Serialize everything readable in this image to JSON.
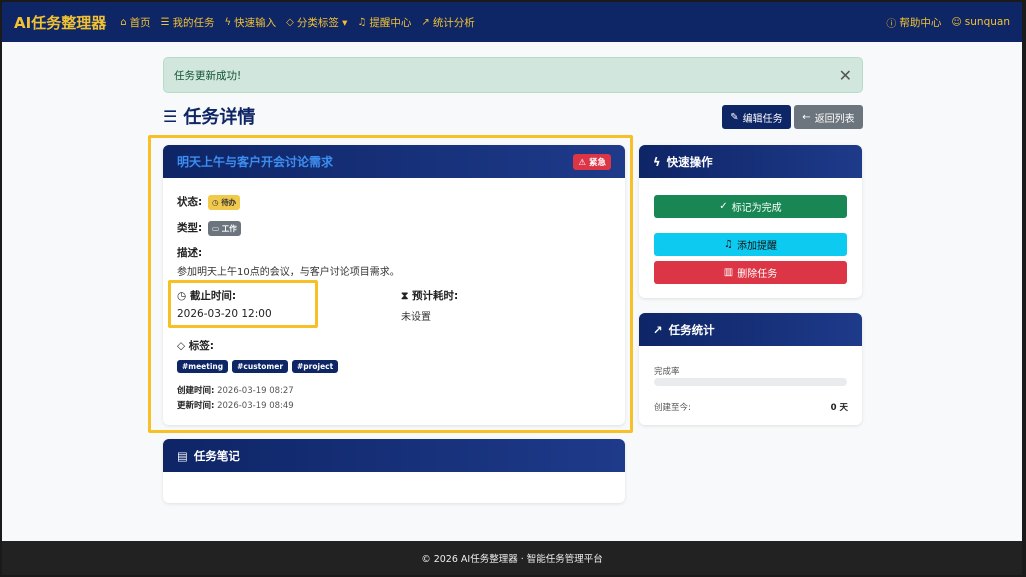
{
  "navbar": {
    "brand": "AI任务整理器",
    "items": [
      {
        "icon": "home-icon",
        "glyph": "⌂",
        "label": "首页"
      },
      {
        "icon": "list-icon",
        "glyph": "☰",
        "label": "我的任务"
      },
      {
        "icon": "lightning-icon",
        "glyph": "ϟ",
        "label": "快速输入"
      },
      {
        "icon": "tag-icon",
        "glyph": "◇",
        "label": "分类标签 ▾"
      },
      {
        "icon": "bell-icon",
        "glyph": "♫",
        "label": "提醒中心"
      },
      {
        "icon": "chart-icon",
        "glyph": "↗",
        "label": "统计分析"
      }
    ],
    "help": "帮助中心",
    "user": "sunquan"
  },
  "alert": {
    "text": "任务更新成功!"
  },
  "page": {
    "title": "任务详情",
    "edit_label": "编辑任务",
    "back_label": "返回列表"
  },
  "task": {
    "title": "明天上午与客户开会讨论需求",
    "priority": "紧急",
    "status_label": "状态:",
    "status": "待办",
    "type_label": "类型:",
    "type": "工作",
    "desc_label": "描述:",
    "description": "参加明天上午10点的会议，与客户讨论项目需求。",
    "deadline_label": "截止时间:",
    "deadline": "2026-03-20 12:00",
    "estimate_label": "预计耗时:",
    "estimate": "未设置",
    "tags_label": "标签:",
    "tags": [
      "#meeting",
      "#customer",
      "#project"
    ],
    "created_label": "创建时间:",
    "created": "2026-03-19 08:27",
    "updated_label": "更新时间:",
    "updated": "2026-03-19 08:49"
  },
  "quick": {
    "title": "快速操作",
    "complete": "标记为完成",
    "reminder": "添加提醒",
    "delete": "删除任务"
  },
  "stats": {
    "title": "任务统计",
    "completion_label": "完成率",
    "completion_percent": 0,
    "created_since_label": "创建至今:",
    "created_since": "0 天"
  },
  "notes": {
    "title": "任务笔记"
  },
  "footer": {
    "text": "© 2026 AI任务整理器 · 智能任务管理平台"
  },
  "colors": {
    "navbar": "#0e2566",
    "accent": "#f1c232",
    "success": "#198754",
    "info": "#0dcaf0",
    "danger": "#dc3545",
    "highlight": "#f6c026"
  }
}
